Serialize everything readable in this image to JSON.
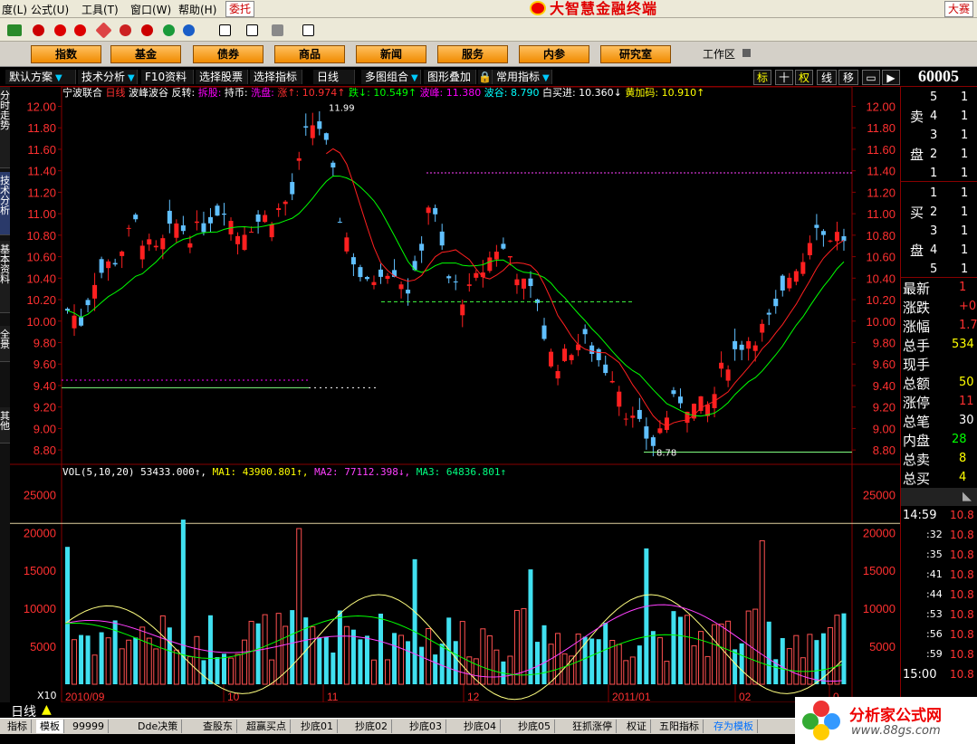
{
  "menu": {
    "items": [
      "度(L)",
      "公式(U)",
      "工具(T)",
      "窗口(W)",
      "帮助(H)"
    ],
    "trust": "委托",
    "app_title": "大智慧金融终端",
    "race": "大赛"
  },
  "nav": {
    "items": [
      "指数",
      "基金",
      "债券",
      "商品",
      "新闻",
      "服务",
      "内参",
      "研究室"
    ],
    "workarea": "工作区"
  },
  "subbar": {
    "items": [
      "默认方案",
      "技术分析",
      "F10资料",
      "选择股票",
      "选择指标",
      "日线",
      "多图组合",
      "图形叠加",
      "常用指标"
    ],
    "right_buttons": [
      "标",
      "十",
      "权",
      "线",
      "移"
    ],
    "stock_code": "60005"
  },
  "left_tabs": [
    "分时走势",
    "技术分析",
    "基本资料",
    "全景",
    "其他"
  ],
  "kline_header": {
    "name": "宁波联合",
    "period": "日线",
    "indicator": "波峰波谷",
    "segments": [
      {
        "t": "反转:",
        "c": "#ffffff"
      },
      {
        "t": "拆股:",
        "c": "#ff00ff"
      },
      {
        "t": "持币:",
        "c": "#ffffff"
      },
      {
        "t": "洗盘:",
        "c": "#ff00ff"
      },
      {
        "t": "涨↑: 10.974↑",
        "c": "#ff3030"
      },
      {
        "t": "跌↓: 10.549↑",
        "c": "#00ff00"
      },
      {
        "t": "波峰: 11.380",
        "c": "#ff00ff"
      },
      {
        "t": "波谷: 8.790",
        "c": "#00ffff"
      },
      {
        "t": "白买进: 10.360↓",
        "c": "#ffffff"
      },
      {
        "t": "黄加码: 10.910↑",
        "c": "#ffff00"
      }
    ]
  },
  "vol_header": {
    "label": "VOL(5,10,20)",
    "vol": "53433.000↑",
    "ma1": "MA1: 43900.801↑",
    "ma2": "MA2: 77112.398↓",
    "ma3": "MA3: 64836.801↑"
  },
  "price_axis": [
    "12.00",
    "11.80",
    "11.60",
    "11.40",
    "11.20",
    "11.00",
    "10.80",
    "10.60",
    "10.40",
    "10.20",
    "10.00",
    "9.80",
    "9.60",
    "9.40",
    "9.20",
    "9.00",
    "8.80"
  ],
  "vol_axis": [
    "25000",
    "20000",
    "15000",
    "10000",
    "5000"
  ],
  "date_axis": [
    "2010/09",
    "10",
    "11",
    "12",
    "2011/01",
    "02",
    "0"
  ],
  "annotations": {
    "high": "11.99",
    "low": "8.78",
    "x10": "X10",
    "period_tab": "日线"
  },
  "bottom_tabs": [
    "指标",
    "模板",
    "99999",
    "Dde决策",
    "查股东",
    "超赢买点",
    "抄底01",
    "抄底02",
    "抄底03",
    "抄底04",
    "抄底05",
    "狂抓涨停",
    "权证",
    "五阳指标",
    "存为模板"
  ],
  "right_panel": {
    "sell_label": [
      "卖",
      "盘"
    ],
    "buy_label": [
      "买",
      "盘"
    ],
    "sell_levels": [
      "5",
      "4",
      "3",
      "2",
      "1"
    ],
    "buy_levels": [
      "1",
      "2",
      "3",
      "4",
      "5"
    ],
    "sell_values": [
      "1",
      "1",
      "1",
      "1",
      "1"
    ],
    "buy_values": [
      "1",
      "1",
      "1",
      "1",
      "1"
    ],
    "stats": [
      {
        "k": "最新",
        "v": "1",
        "c": "#ff3030"
      },
      {
        "k": "涨跌",
        "v": "+0",
        "c": "#ff3030"
      },
      {
        "k": "涨幅",
        "v": "1.7",
        "c": "#ff3030"
      },
      {
        "k": "总手",
        "v": "534",
        "c": "#ffff00"
      },
      {
        "k": "现手",
        "v": "",
        "c": "#ffff00"
      },
      {
        "k": "总额",
        "v": "50",
        "c": "#ffff00"
      },
      {
        "k": "涨停",
        "v": "11",
        "c": "#ff3030"
      },
      {
        "k": "总笔",
        "v": "30",
        "c": "#ffffff"
      },
      {
        "k": "内盘",
        "v": "28",
        "c": "#00ff00"
      },
      {
        "k": "总卖",
        "v": "8",
        "c": "#ffff00"
      },
      {
        "k": "总买",
        "v": "4",
        "c": "#ffff00"
      }
    ],
    "ticks": [
      {
        "t": "14:59",
        "v": "10.8"
      },
      {
        "t": ":32",
        "v": "10.8"
      },
      {
        "t": ":35",
        "v": "10.8"
      },
      {
        "t": ":41",
        "v": "10.8"
      },
      {
        "t": ":44",
        "v": "10.8"
      },
      {
        "t": ":53",
        "v": "10.8"
      },
      {
        "t": ":56",
        "v": "10.8"
      },
      {
        "t": ":59",
        "v": "10.8"
      },
      {
        "t": "15:00",
        "v": "10.8"
      }
    ]
  },
  "watermark": {
    "title": "分析家公式网",
    "url": "www.88gs.com"
  },
  "colors": {
    "up": "#ff2020",
    "down": "#60c0ff",
    "grid": "#880000",
    "ma": "#00ff00",
    "ma_red": "#ff2020"
  }
}
